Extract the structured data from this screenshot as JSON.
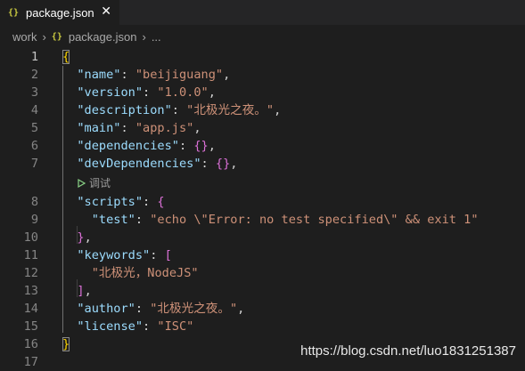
{
  "tab": {
    "icon": "{}",
    "label": "package.json",
    "close": "✕"
  },
  "breadcrumb": {
    "items": [
      "work",
      "package.json",
      "..."
    ],
    "file_icon": "{}"
  },
  "codelens": {
    "label": "调试",
    "icon": "play-icon"
  },
  "lines": [
    {
      "n": "1",
      "tokens": [
        {
          "t": "{",
          "c": "b1"
        }
      ]
    },
    {
      "n": "2",
      "tokens": [
        {
          "t": "  ",
          "c": "p"
        },
        {
          "t": "\"name\"",
          "c": "k"
        },
        {
          "t": ": ",
          "c": "p"
        },
        {
          "t": "\"beijiguang\"",
          "c": "s"
        },
        {
          "t": ",",
          "c": "p"
        }
      ]
    },
    {
      "n": "3",
      "tokens": [
        {
          "t": "  ",
          "c": "p"
        },
        {
          "t": "\"version\"",
          "c": "k"
        },
        {
          "t": ": ",
          "c": "p"
        },
        {
          "t": "\"1.0.0\"",
          "c": "s"
        },
        {
          "t": ",",
          "c": "p"
        }
      ]
    },
    {
      "n": "4",
      "tokens": [
        {
          "t": "  ",
          "c": "p"
        },
        {
          "t": "\"description\"",
          "c": "k"
        },
        {
          "t": ": ",
          "c": "p"
        },
        {
          "t": "\"北极光之夜。\"",
          "c": "s"
        },
        {
          "t": ",",
          "c": "p"
        }
      ]
    },
    {
      "n": "5",
      "tokens": [
        {
          "t": "  ",
          "c": "p"
        },
        {
          "t": "\"main\"",
          "c": "k"
        },
        {
          "t": ": ",
          "c": "p"
        },
        {
          "t": "\"app.js\"",
          "c": "s"
        },
        {
          "t": ",",
          "c": "p"
        }
      ]
    },
    {
      "n": "6",
      "tokens": [
        {
          "t": "  ",
          "c": "p"
        },
        {
          "t": "\"dependencies\"",
          "c": "k"
        },
        {
          "t": ": ",
          "c": "p"
        },
        {
          "t": "{}",
          "c": "b2"
        },
        {
          "t": ",",
          "c": "p"
        }
      ]
    },
    {
      "n": "7",
      "tokens": [
        {
          "t": "  ",
          "c": "p"
        },
        {
          "t": "\"devDependencies\"",
          "c": "k"
        },
        {
          "t": ": ",
          "c": "p"
        },
        {
          "t": "{}",
          "c": "b2"
        },
        {
          "t": ",",
          "c": "p"
        }
      ]
    },
    {
      "n": "8",
      "tokens": [
        {
          "t": "  ",
          "c": "p"
        },
        {
          "t": "\"scripts\"",
          "c": "k"
        },
        {
          "t": ": ",
          "c": "p"
        },
        {
          "t": "{",
          "c": "b2"
        }
      ]
    },
    {
      "n": "9",
      "tokens": [
        {
          "t": "    ",
          "c": "p"
        },
        {
          "t": "\"test\"",
          "c": "k"
        },
        {
          "t": ": ",
          "c": "p"
        },
        {
          "t": "\"echo \\\"Error: no test specified\\\" && exit 1\"",
          "c": "s"
        }
      ]
    },
    {
      "n": "10",
      "tokens": [
        {
          "t": "  ",
          "c": "p"
        },
        {
          "t": "}",
          "c": "b2"
        },
        {
          "t": ",",
          "c": "p"
        }
      ]
    },
    {
      "n": "11",
      "tokens": [
        {
          "t": "  ",
          "c": "p"
        },
        {
          "t": "\"keywords\"",
          "c": "k"
        },
        {
          "t": ": ",
          "c": "p"
        },
        {
          "t": "[",
          "c": "b2"
        }
      ]
    },
    {
      "n": "12",
      "tokens": [
        {
          "t": "    ",
          "c": "p"
        },
        {
          "t": "\"北极光，NodeJS\"",
          "c": "s"
        }
      ]
    },
    {
      "n": "13",
      "tokens": [
        {
          "t": "  ",
          "c": "p"
        },
        {
          "t": "]",
          "c": "b2"
        },
        {
          "t": ",",
          "c": "p"
        }
      ]
    },
    {
      "n": "14",
      "tokens": [
        {
          "t": "  ",
          "c": "p"
        },
        {
          "t": "\"author\"",
          "c": "k"
        },
        {
          "t": ": ",
          "c": "p"
        },
        {
          "t": "\"北极光之夜。\"",
          "c": "s"
        },
        {
          "t": ",",
          "c": "p"
        }
      ]
    },
    {
      "n": "15",
      "tokens": [
        {
          "t": "  ",
          "c": "p"
        },
        {
          "t": "\"license\"",
          "c": "k"
        },
        {
          "t": ": ",
          "c": "p"
        },
        {
          "t": "\"ISC\"",
          "c": "s"
        }
      ]
    },
    {
      "n": "16",
      "tokens": [
        {
          "t": "}",
          "c": "b1"
        }
      ]
    },
    {
      "n": "17",
      "tokens": []
    }
  ],
  "active_line": "1",
  "watermark": "https://blog.csdn.net/luo1831251387",
  "colors": {
    "background": "#1e1e1e",
    "tab_bar": "#252526",
    "json_key": "#9cdcfe",
    "json_string": "#ce9178",
    "bracket_level1": "#ffd700",
    "bracket_level2": "#da70d6",
    "json_icon": "#cbcb41"
  }
}
